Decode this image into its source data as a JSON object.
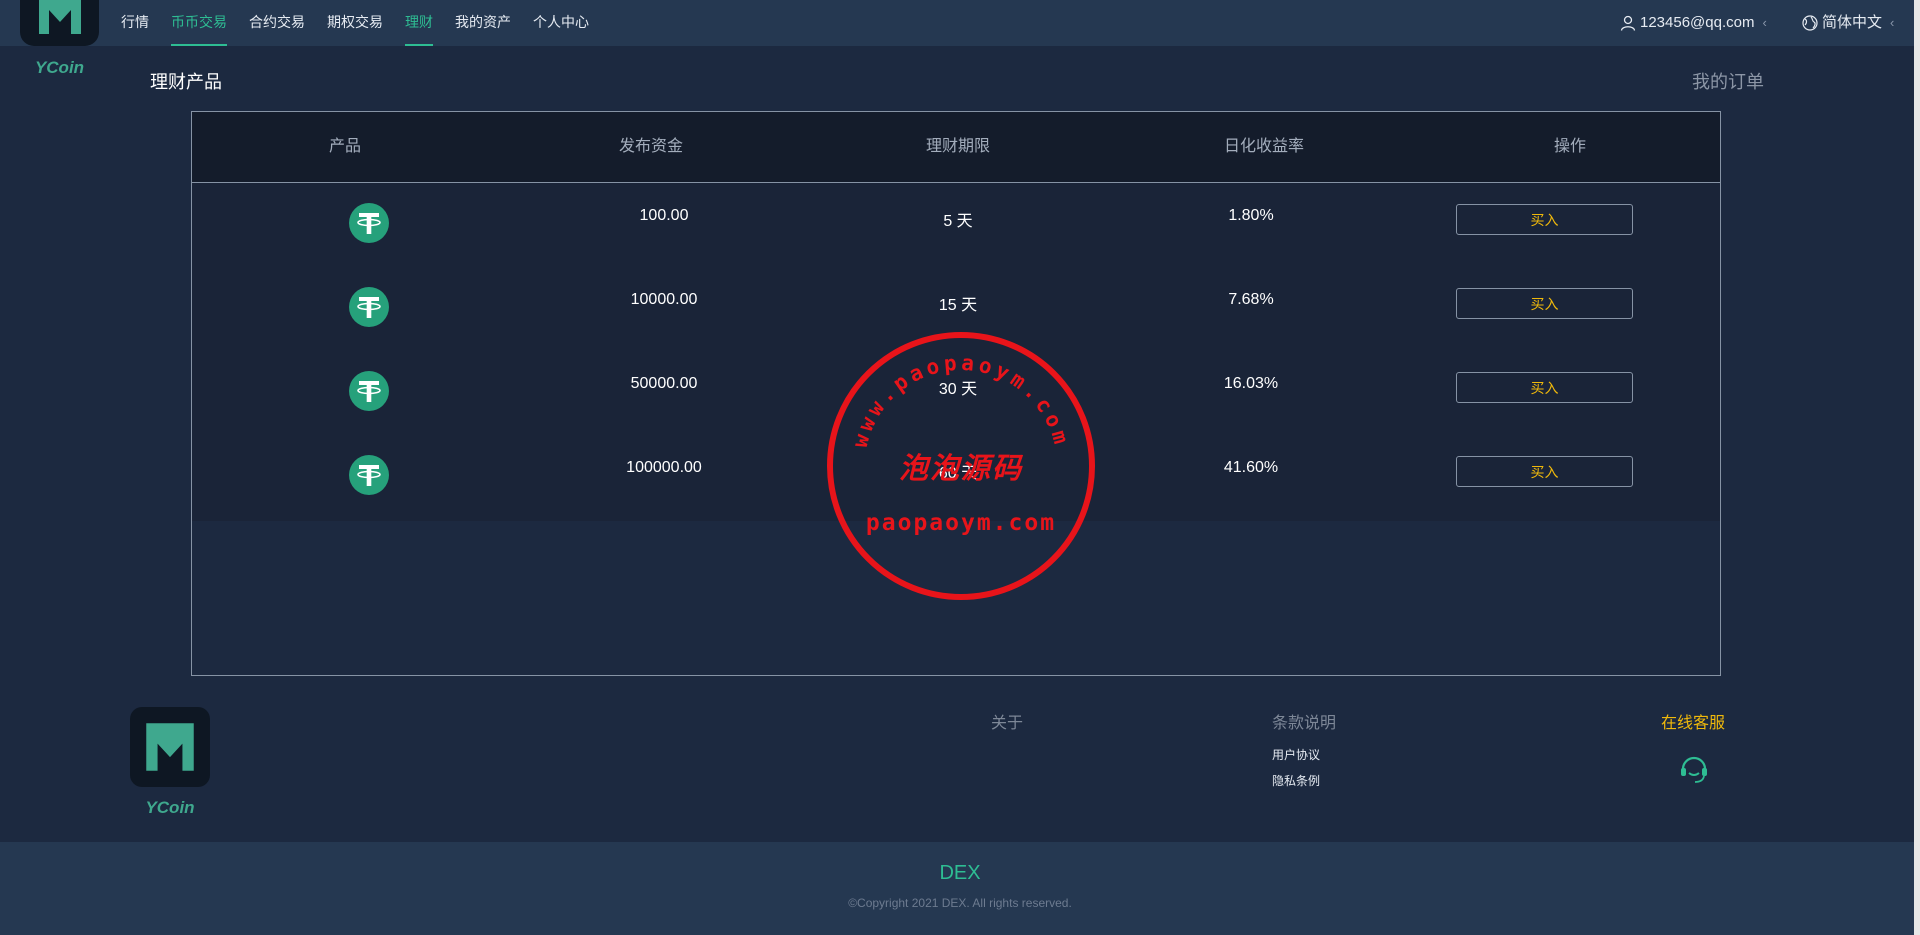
{
  "header": {
    "brand": "YCoin",
    "nav": [
      {
        "label": "行情"
      },
      {
        "label": "币币交易"
      },
      {
        "label": "合约交易"
      },
      {
        "label": "期权交易"
      },
      {
        "label": "理财"
      },
      {
        "label": "我的资产"
      },
      {
        "label": "个人中心"
      }
    ],
    "active_nav": "理财",
    "user_email": "123456@qq.com",
    "language": "简体中文",
    "chevron": "‹"
  },
  "page": {
    "title": "理财产品",
    "my_orders": "我的订单"
  },
  "table": {
    "columns": [
      "产品",
      "发布资金",
      "理财期限",
      "日化收益率",
      "操作"
    ],
    "rows": [
      {
        "icon": "tether-icon",
        "amount": "100.00",
        "term": "5 天",
        "rate": "1.80%",
        "action": "买入"
      },
      {
        "icon": "tether-icon",
        "amount": "10000.00",
        "term": "15 天",
        "rate": "7.68%",
        "action": "买入"
      },
      {
        "icon": "tether-icon",
        "amount": "50000.00",
        "term": "30 天",
        "rate": "16.03%",
        "action": "买入"
      },
      {
        "icon": "tether-icon",
        "amount": "100000.00",
        "term": "60 天",
        "rate": "41.60%",
        "action": "买入"
      }
    ]
  },
  "footer": {
    "brand": "YCoin",
    "about": "关于",
    "terms_title": "条款说明",
    "terms_links": [
      "用户协议",
      "隐私条例"
    ],
    "service_title": "在线客服",
    "service_icon": "headset-icon",
    "site_name": "DEX",
    "copyright": "©Copyright 2021 DEX. All rights reserved."
  },
  "watermark": {
    "arc_text": "www.paopaoym.com",
    "cn_text": "泡泡源码",
    "bottom_text": "paopaoym.com"
  },
  "colors": {
    "accent_green": "#2ebd93",
    "accent_gold": "#f0b90b",
    "stamp_red": "#e8141a",
    "bg": "#1c2940",
    "bar": "#253851"
  }
}
